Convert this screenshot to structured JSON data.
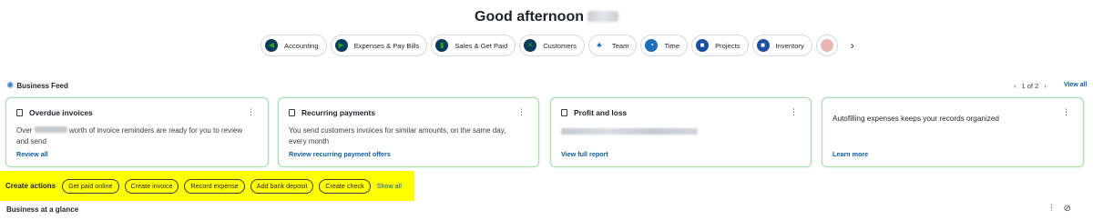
{
  "greeting": "Good afternoon",
  "nav_pills": [
    {
      "label": "Accounting",
      "icon": "accounting-icon"
    },
    {
      "label": "Expenses & Pay Bills",
      "icon": "expenses-icon"
    },
    {
      "label": "Sales & Get Paid",
      "icon": "sales-icon"
    },
    {
      "label": "Customers",
      "icon": "customers-icon"
    },
    {
      "label": "Team",
      "icon": "team-icon"
    },
    {
      "label": "Time",
      "icon": "time-icon"
    },
    {
      "label": "Projects",
      "icon": "projects-icon"
    },
    {
      "label": "Inventory",
      "icon": "inventory-icon"
    }
  ],
  "feed": {
    "title": "Business Feed",
    "pager": "1 of 2",
    "view_all": "View all",
    "cards": [
      {
        "title": "Overdue invoices",
        "body_prefix": "Over",
        "body_suffix": "worth of invoice reminders are ready for you to review and send",
        "link": "Review all"
      },
      {
        "title": "Recurring payments",
        "body": "You send customers invoices for similar amounts, on the same day, every month",
        "link": "Review recurring payment offers"
      },
      {
        "title": "Profit and loss",
        "link": "View full report"
      },
      {
        "title": "Autofilling expenses keeps your records organized",
        "link": "Learn more"
      }
    ]
  },
  "create_actions": {
    "label": "Create actions",
    "buttons": [
      "Get paid online",
      "Create invoice",
      "Record expense",
      "Add bank deposit",
      "Create check"
    ],
    "show_all": "Show all"
  },
  "glance": {
    "title": "Business at a glance"
  },
  "colors": {
    "accent_link": "#0d5da8",
    "highlight": "#ffff00",
    "card_border": "#a9dfa2",
    "icon_bg": "#0b3b5c",
    "icon_fg": "#2ca01c"
  }
}
